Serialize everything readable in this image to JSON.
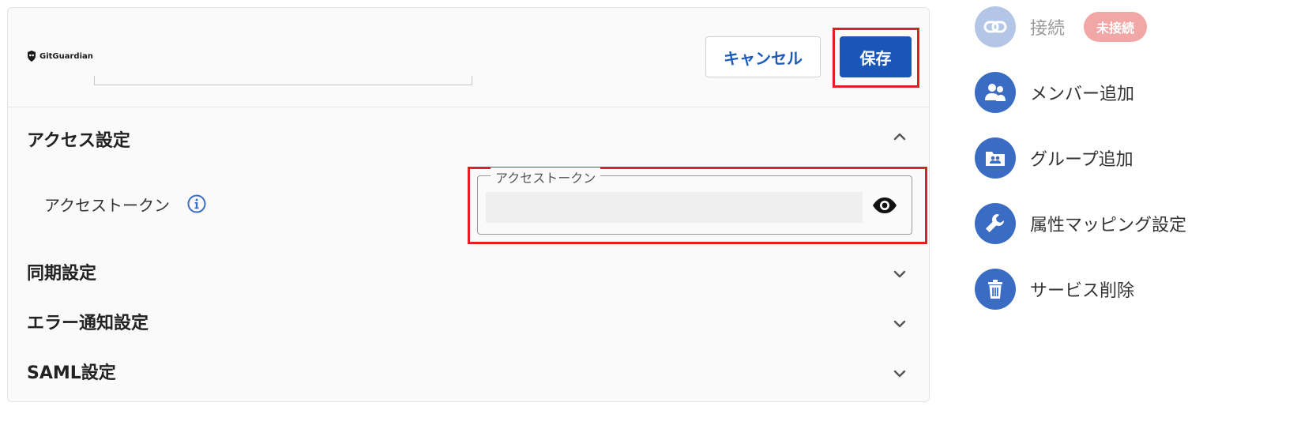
{
  "header": {
    "logo_text": "GitGuardian",
    "cancel_label": "キャンセル",
    "save_label": "保存"
  },
  "sections": [
    {
      "title": "アクセス設定",
      "expanded": true
    },
    {
      "title": "同期設定",
      "expanded": false
    },
    {
      "title": "エラー通知設定",
      "expanded": false
    },
    {
      "title": "SAML設定",
      "expanded": false
    }
  ],
  "access": {
    "token_label": "アクセストークン",
    "field_legend": "アクセストークン",
    "field_value": ""
  },
  "sidebar": {
    "items": [
      {
        "label": "接続",
        "icon": "link-icon",
        "badge": "未接続",
        "disabled": true
      },
      {
        "label": "メンバー追加",
        "icon": "add-member-icon"
      },
      {
        "label": "グループ追加",
        "icon": "add-group-icon"
      },
      {
        "label": "属性マッピング設定",
        "icon": "wrench-icon"
      },
      {
        "label": "サービス削除",
        "icon": "trash-icon"
      }
    ]
  },
  "colors": {
    "primary": "#1a56b8",
    "icon_bg": "#3a6cc4",
    "highlight": "#e02020",
    "badge_bg": "#f2a7a7"
  }
}
